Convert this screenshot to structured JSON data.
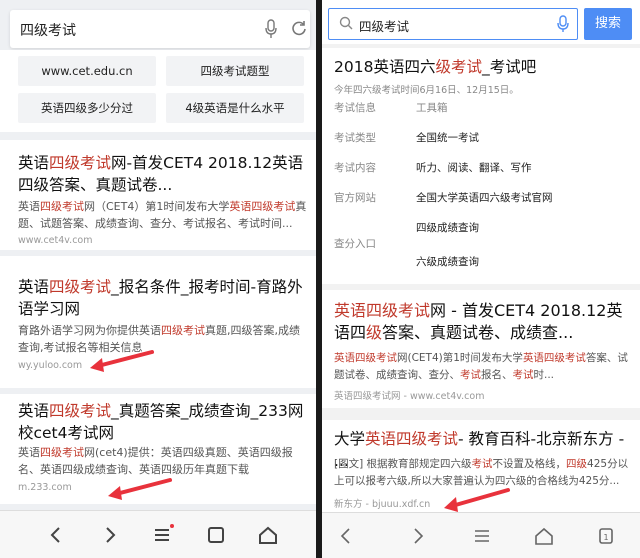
{
  "left": {
    "search_query": "四级考试",
    "chips": [
      "www.cet.edu.cn",
      "四级考试题型",
      "英语四级多少分过",
      "4级英语是什么水平"
    ],
    "results": [
      {
        "title_parts": [
          "英语",
          "四级考试",
          "网-首发CET4 2018.12英语四级答案、真题试卷..."
        ],
        "desc_parts": [
          "英语",
          "四级考试",
          "网（CET4）第1时间发布大学",
          "英语四级考试",
          "真题、试题答案、成绩查询、查分、考试报名、考试时间..."
        ],
        "url": "www.cet4v.com"
      },
      {
        "title_parts": [
          "英语",
          "四级考试",
          "_报名条件_报考时间-育路外语学习网"
        ],
        "desc_parts": [
          "育路外语学习网为你提供英语",
          "四级考试",
          "真题,四级答案,成绩查询,考试报名等相关信息",
          "",
          ""
        ],
        "url": "wy.yuloo.com"
      },
      {
        "title_parts": [
          "英语",
          "四级考试",
          "_真题答案_成绩查询_233网校cet4考试网"
        ],
        "desc_parts": [
          "英语",
          "四级考试",
          "网(cet4)提供：英语四级真题、英语四级报名、英语四级成绩查询、英语四级历年真题下载",
          "",
          ""
        ],
        "url": "m.233.com"
      }
    ],
    "nav": [
      "back-icon",
      "forward-icon",
      "menu-icon",
      "tabs-icon",
      "home-icon"
    ]
  },
  "right": {
    "search_query": "四级考试",
    "search_button": "搜索",
    "card1": {
      "title_parts": [
        "2018英语四六",
        "级考试",
        "_考试吧"
      ],
      "subtitle": "今年四六级考试时间6月16日、12月15日。",
      "rows": [
        {
          "k": "考试信息",
          "v": "工具箱"
        },
        {
          "k": "考试类型",
          "v": "全国统一考试"
        },
        {
          "k": "考试内容",
          "v": "听力、阅读、翻译、写作"
        },
        {
          "k": "官方网站",
          "v": "全国大学英语四六级考试官网"
        },
        {
          "k": "",
          "v": "四级成绩查询"
        },
        {
          "k": "查分入口",
          "v": ""
        },
        {
          "k": "",
          "v": "六级成绩查询"
        }
      ]
    },
    "card2": {
      "title_parts": [
        "英语四级考试",
        "网 - 首发CET4 2018.12英语四",
        "级",
        "答案、真题试卷、成绩查..."
      ],
      "desc_parts": [
        "英语四级考试",
        "网(CET4)第1时间发布大学",
        "英语四级考试",
        "答案、试题试卷、成绩查询、查分、",
        "考试",
        "报名、",
        "考试",
        "时..."
      ],
      "url": "英语四级考试网 - www.cet4v.com"
    },
    "card3": {
      "title_parts": [
        "大学",
        "英语四级考试",
        "- 教育百科-北京新东方 - ..."
      ],
      "desc_parts": [
        "[图文] 根据教育部规定四六级",
        "考试",
        "不设置及格线，",
        "四级",
        "425分以上可以报考六级,所以大家普遍认为四六级的合格线为425分..."
      ],
      "url": "新东方 - bjuuu.xdf.cn"
    },
    "nav": [
      "back-icon",
      "forward-icon",
      "menu-icon",
      "home-icon",
      "tabs-icon"
    ]
  },
  "colors": {
    "highlight": "#c0392b",
    "accent": "#4e8df5",
    "arrow": "#e8323c"
  }
}
